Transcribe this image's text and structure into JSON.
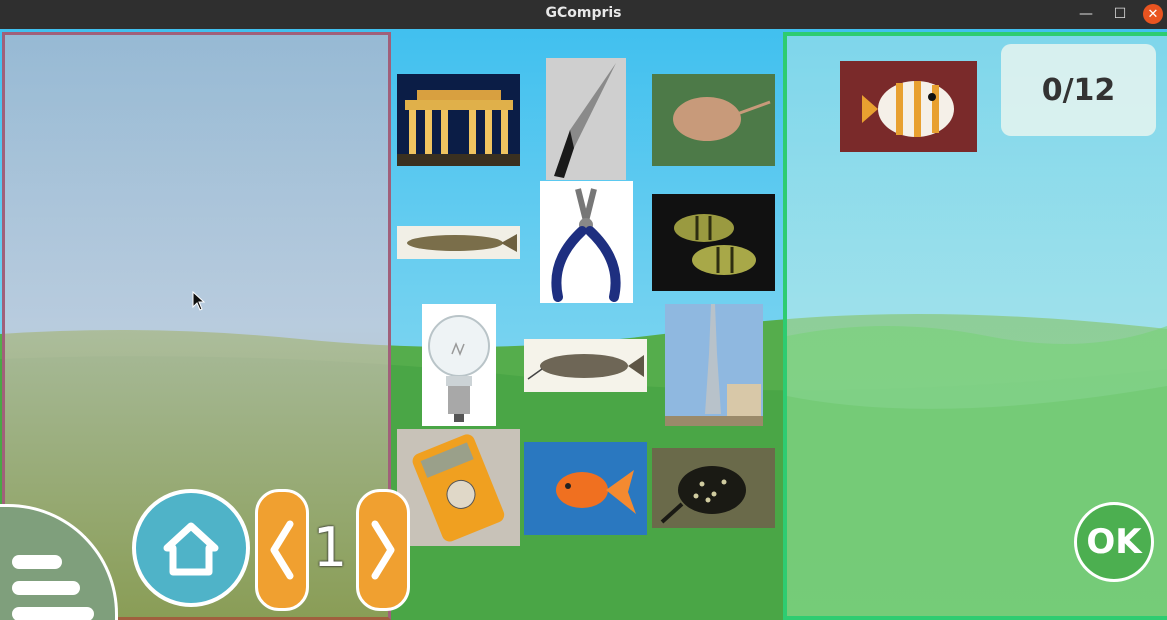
{
  "window": {
    "title": "GCompris"
  },
  "score": {
    "text": "0/12"
  },
  "level": {
    "number": "1"
  },
  "ok_button": {
    "label": "OK"
  },
  "icons": {
    "menu": "menu-icon",
    "home": "home-icon",
    "previous": "chevron-left-icon",
    "next": "chevron-right-icon"
  },
  "items": [
    {
      "name": "brandenburg-gate"
    },
    {
      "name": "knife"
    },
    {
      "name": "stingray"
    },
    {
      "name": "fish-pike"
    },
    {
      "name": "pliers"
    },
    {
      "name": "perch-fish"
    },
    {
      "name": "light-bulb"
    },
    {
      "name": "catfish"
    },
    {
      "name": "skyscraper"
    },
    {
      "name": "multimeter"
    },
    {
      "name": "goldfish"
    },
    {
      "name": "spotted-ray"
    }
  ],
  "target_item": {
    "name": "butterfly-fish"
  },
  "colors": {
    "sky": "#41c0ef",
    "grass": "#4aa646",
    "left_border": "#a0607a",
    "right_border": "#2ecc71",
    "accent_orange": "#f0a030",
    "home_blue": "#4fb3c8"
  }
}
